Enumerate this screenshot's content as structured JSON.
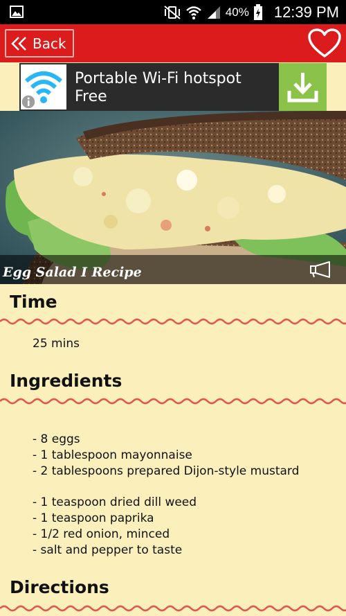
{
  "status_bar": {
    "battery_percent": "40%",
    "time": "12:39 PM"
  },
  "app_bar": {
    "back_label": "Back"
  },
  "ad": {
    "title_line1": "Portable Wi-Fi hotspot",
    "title_line2": "Free"
  },
  "recipe": {
    "title": "Egg Salad I Recipe"
  },
  "sections": {
    "time_heading": "Time",
    "time_value": "25 mins",
    "ingredients_heading": "Ingredients",
    "directions_heading": "Directions"
  },
  "ingredients": [
    "-  8 eggs",
    "-  1 tablespoon mayonnaise",
    "-  2 tablespoons prepared Dijon-style mustard",
    "",
    "-  1 teaspoon dried dill weed",
    "-  1 teaspoon paprika",
    "-  1/2 red onion, minced",
    "-  salt and pepper to taste"
  ],
  "colors": {
    "app_bar": "#dc1c1c",
    "background": "#fbefbb",
    "wave": "#e0584a",
    "ad_download": "#8bc34a"
  },
  "icons": {
    "status_left": "image-icon",
    "back": "double-chevron-left-icon",
    "favorite": "heart-outline-icon",
    "ad_app": "wifi-icon",
    "ad_info": "info-icon",
    "ad_action": "download-icon",
    "share": "megaphone-icon"
  }
}
